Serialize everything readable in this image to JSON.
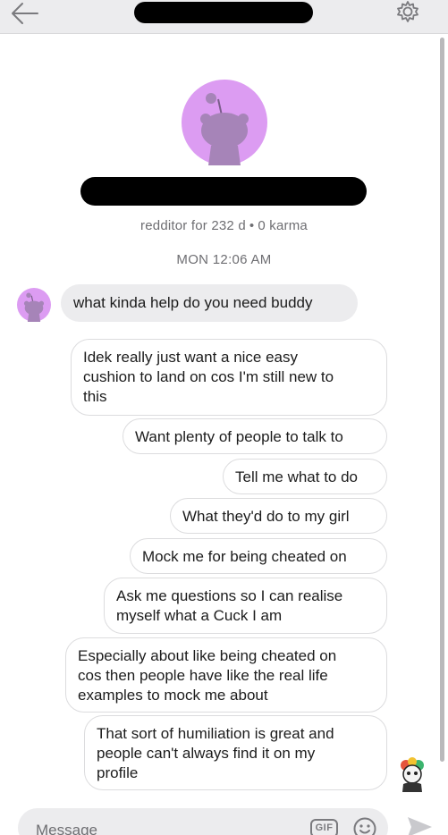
{
  "header": {
    "back_icon": "arrow-left-icon",
    "settings_icon": "gear-icon"
  },
  "profile": {
    "meta_prefix": "redditor for 232 d",
    "separator": "•",
    "meta_suffix": "0 karma"
  },
  "timestamp": "MON 12:06 AM",
  "messages": {
    "incoming": [
      "what kinda help do you need buddy"
    ],
    "outgoing": [
      "Idek really just want a nice easy\ncushion to land on cos I'm still new to\nthis",
      "Want plenty of people to talk to",
      "Tell me what to do",
      "What they'd do to my girl",
      "Mock me for being cheated on",
      "Ask me questions so I can realise\nmyself what a Cuck I am",
      "Especially about like being cheated on\ncos then people have like the real life\nexamples to mock me about",
      "That sort of humiliation is great and\npeople can't always find it on my\nprofile"
    ]
  },
  "composer": {
    "placeholder": "Message",
    "gif_label": "GIF",
    "emoji_icon": "smiley-icon",
    "send_icon": "send-icon"
  },
  "colors": {
    "bubble_in": "#ececee",
    "snoo_purple": "#dc9cf2",
    "snoo_body": "#a684b8",
    "muted_text": "#6e6e72"
  }
}
